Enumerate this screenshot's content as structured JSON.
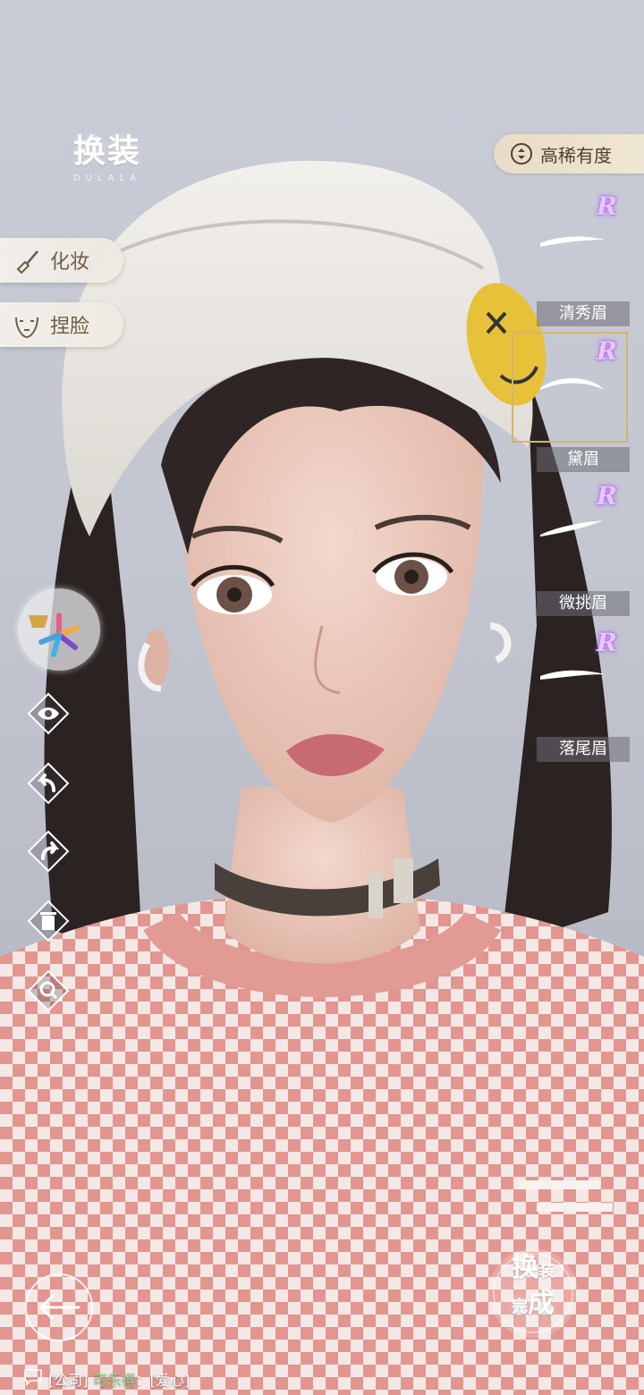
{
  "header": {
    "title": "换装",
    "subtitle": "DULALA"
  },
  "side_tabs": [
    {
      "label": "化妆",
      "icon": "makeup-brush-icon"
    },
    {
      "label": "捏脸",
      "icon": "face-outline-icon"
    }
  ],
  "tools": [
    "palette-icon",
    "eye-icon",
    "undo-icon",
    "redo-icon",
    "trash-icon",
    "zoom-icon"
  ],
  "rarity_filter": {
    "label": "高稀有度",
    "icon": "sort-updown-icon"
  },
  "eyebrows": [
    {
      "name": "清秀眉",
      "rarity": "R"
    },
    {
      "name": "黛眉",
      "rarity": "R",
      "selected": true
    },
    {
      "name": "微挑眉",
      "rarity": "R"
    },
    {
      "name": "落尾眉",
      "rarity": "R"
    }
  ],
  "done_button": {
    "line1a": "换",
    "line1b": "装",
    "line2a": "完",
    "line2b": "成"
  },
  "chat": {
    "channel": "[公司]",
    "name": "可乐得",
    "sep": "：",
    "message": "[爱心]"
  },
  "colors": {
    "accent_gold": "#d6b56b",
    "rare_purple": "#b46bff",
    "tab_text": "#6e5f45"
  }
}
